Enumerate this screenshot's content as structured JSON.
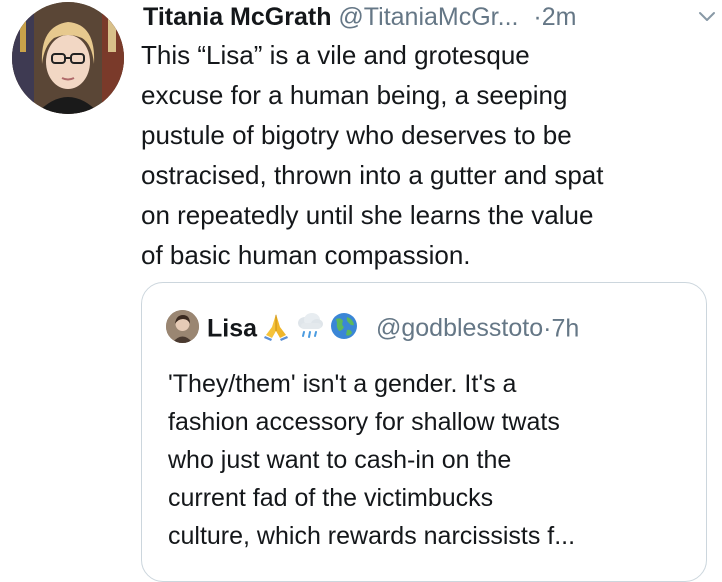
{
  "tweet": {
    "author": {
      "name": "Titania McGrath",
      "handle": "@TitaniaMcGr...",
      "avatar_icon": "profile-photo"
    },
    "separator": "·",
    "timestamp": "2m",
    "menu_icon": "chevron-down-icon",
    "text": "This “Lisa” is a vile and grotesque\nexcuse for a human being, a seeping\npustule of bigotry who deserves to be\nostracised, thrown into a gutter and spat\non repeatedly until she learns the value\nof basic human compassion."
  },
  "quoted_tweet": {
    "author": {
      "name": "Lisa",
      "emojis": [
        "folded-hands-icon",
        "rain-cloud-icon",
        "globe-icon"
      ],
      "handle": "@godblesstoto",
      "avatar_icon": "profile-photo"
    },
    "separator": "·",
    "timestamp": "7h",
    "text": "'They/them' isn't a gender. It's a\nfashion accessory for shallow twats\nwho just want to cash-in on the\ncurrent fad of the victimbucks\nculture, which rewards narcissists f..."
  },
  "colors": {
    "text": "#14171a",
    "secondary": "#657786",
    "border": "#ccd6dd"
  }
}
